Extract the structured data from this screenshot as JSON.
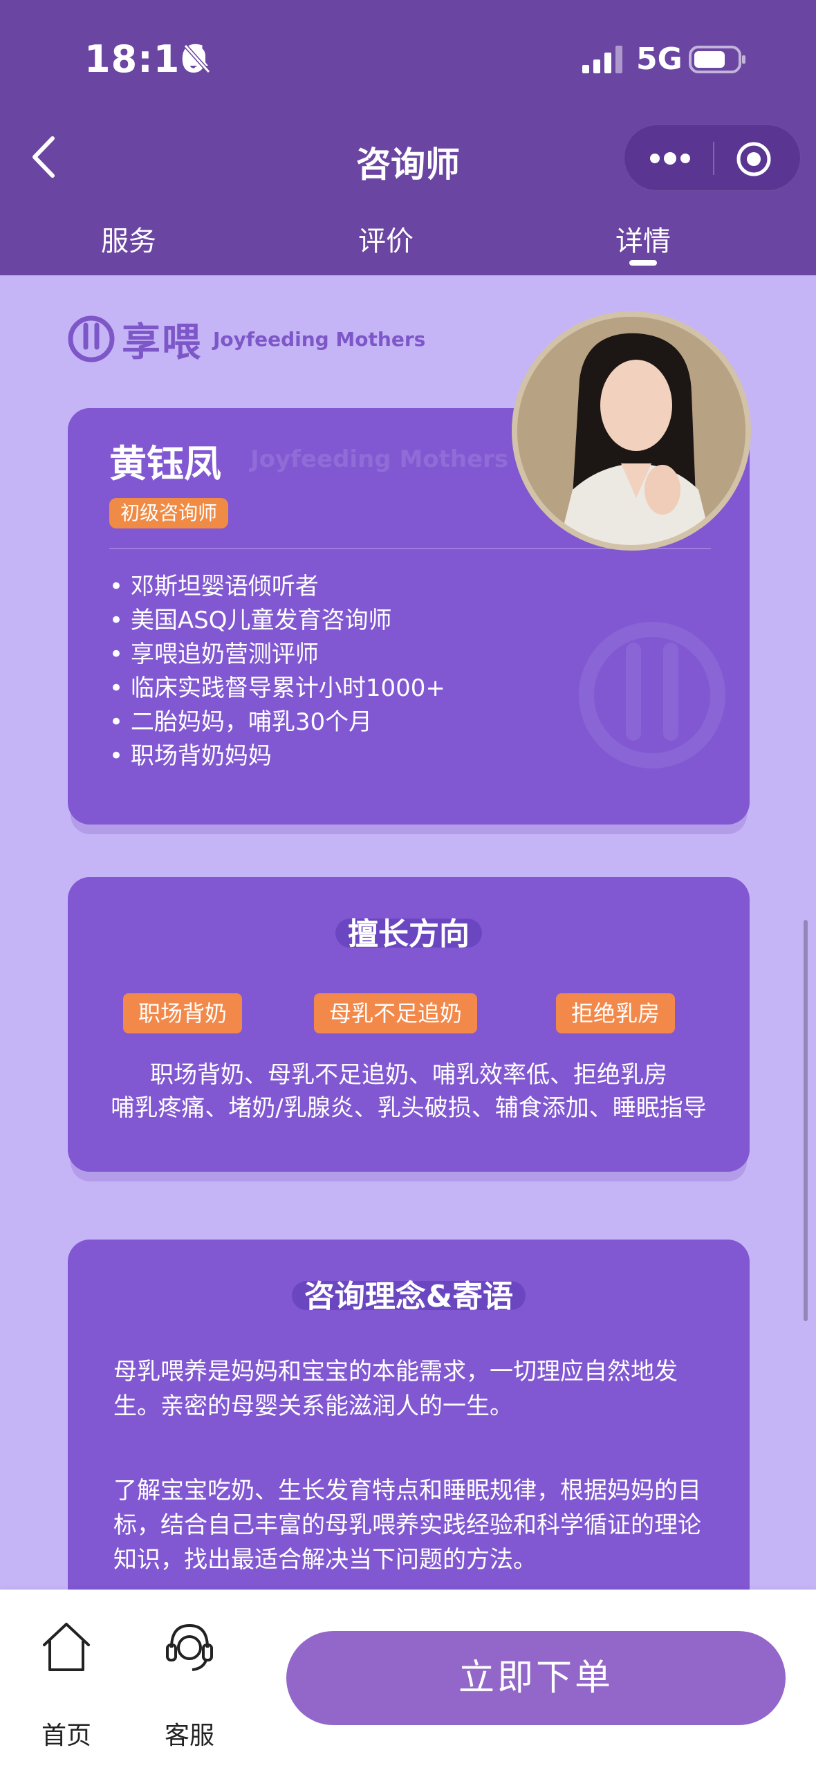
{
  "status": {
    "time": "18:16",
    "network": "5G"
  },
  "nav": {
    "title": "咨询师"
  },
  "tabs": [
    {
      "label": "服务"
    },
    {
      "label": "评价"
    },
    {
      "label": "详情"
    }
  ],
  "brand": {
    "name": "享喂",
    "sub": "Joyfeeding Mothers",
    "watermark": "Joyfeeding Mothers"
  },
  "profile": {
    "name": "黄钰凤",
    "level": "初级咨询师",
    "bullets": [
      "• 邓斯坦婴语倾听者",
      "• 美国ASQ儿童发育咨询师",
      "• 享喂追奶营测评师",
      "• 临床实践督导累计小时1000+",
      "• 二胎妈妈，哺乳30个月",
      "• 职场背奶妈妈"
    ]
  },
  "expertise": {
    "title": "擅长方向",
    "tags": [
      "职场背奶",
      "母乳不足追奶",
      "拒绝乳房"
    ],
    "line1": "职场背奶、母乳不足追奶、哺乳效率低、拒绝乳房",
    "line2": "哺乳疼痛、堵奶/乳腺炎、乳头破损、辅食添加、睡眠指导"
  },
  "philosophy": {
    "title": "咨询理念&寄语",
    "para1": "母乳喂养是妈妈和宝宝的本能需求，一切理应自然地发生。亲密的母婴关系能滋润人的一生。",
    "para2": "了解宝宝吃奶、生长发育特点和睡眠规律，根据妈妈的目标，结合自己丰富的母乳喂养实践经验和科学循证的理论知识，找出最适合解决当下问题的方法。"
  },
  "bottom": {
    "home_label": "首页",
    "service_label": "客服",
    "order_label": "立即下单"
  },
  "colors": {
    "header": "#6a45a2",
    "content_bg": "#c5b5f7",
    "card": "#8158d2",
    "tag": "#f2894a",
    "button": "#9366c9"
  }
}
